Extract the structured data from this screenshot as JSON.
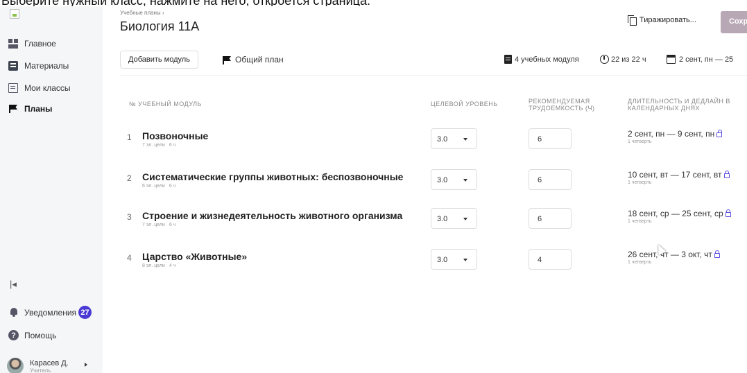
{
  "caption": "Выберите нужный класс, нажмите на него, откроется страница.",
  "sidebar": {
    "items": [
      {
        "label": "Главное",
        "icon": "dashboard-icon"
      },
      {
        "label": "Материалы",
        "icon": "book-icon"
      },
      {
        "label": "Мои классы",
        "icon": "class-icon"
      },
      {
        "label": "Планы",
        "icon": "flag-icon"
      }
    ],
    "collapse_glyph": "|◂",
    "notifications": {
      "label": "Уведомления",
      "count": "27"
    },
    "help": {
      "label": "Помощь",
      "glyph": "?"
    },
    "user": {
      "name": "Карасев Д.",
      "role": "Учитель"
    }
  },
  "header": {
    "breadcrumb": "Учебные планы ›",
    "title": "Биология 11А",
    "duplicate_label": "Тиражировать...",
    "save_label": "Сохр"
  },
  "toolbar": {
    "add_module_label": "Добавить модуль",
    "general_plan_label": "Общий план",
    "modules_count": "4 учебных модуля",
    "hours": "22 из 22 ч",
    "date_range": "2 сент, пн — 25 "
  },
  "table": {
    "headers": {
      "module": "№  УЧЕБНЫЙ МОДУЛЬ",
      "level": "ЦЕЛЕВОЙ УРОВЕНЬ",
      "workload_1": "РЕКОМЕНДУЕМАЯ",
      "workload_2": "ТРУДОЕМКОСТЬ (Ч)",
      "duration_1": "ДЛИТЕЛЬНОСТЬ И ДЕДЛАЙН В",
      "duration_2": "КАЛЕНДАРНЫХ ДНЯХ"
    },
    "rows": [
      {
        "num": "1",
        "title": "Позвоночные",
        "goals": "7 эл. цели",
        "hours_meta": "6 ч",
        "level": "3.0",
        "hours": "6",
        "deadline": "2 сент, пн — 9 сент, пн",
        "term": "1 четверть"
      },
      {
        "num": "2",
        "title": "Систематические группы животных: беспозвоночные",
        "goals": "6 эл. цели",
        "hours_meta": "6 ч",
        "level": "3.0",
        "hours": "6",
        "deadline": "10 сент, вт — 17 сент, вт",
        "term": "1 четверть"
      },
      {
        "num": "3",
        "title": "Строение и жизнедеятельность животного организма",
        "goals": "7 эл. цели",
        "hours_meta": "6 ч",
        "level": "3.0",
        "hours": "6",
        "deadline": "18 сент, ср — 25 сент, ср",
        "term": "1 четверть"
      },
      {
        "num": "4",
        "title": "Царство «Животные»",
        "goals": "8 эл. цели",
        "hours_meta": "4 ч",
        "level": "3.0",
        "hours": "4",
        "deadline": "26 сент, чт — 3 окт, чт",
        "term": "1 четверть"
      }
    ]
  },
  "colors": {
    "accent": "#4a3ad4",
    "save_button": "#b8a7b5",
    "sidebar_bg": "#f5f6f8"
  }
}
